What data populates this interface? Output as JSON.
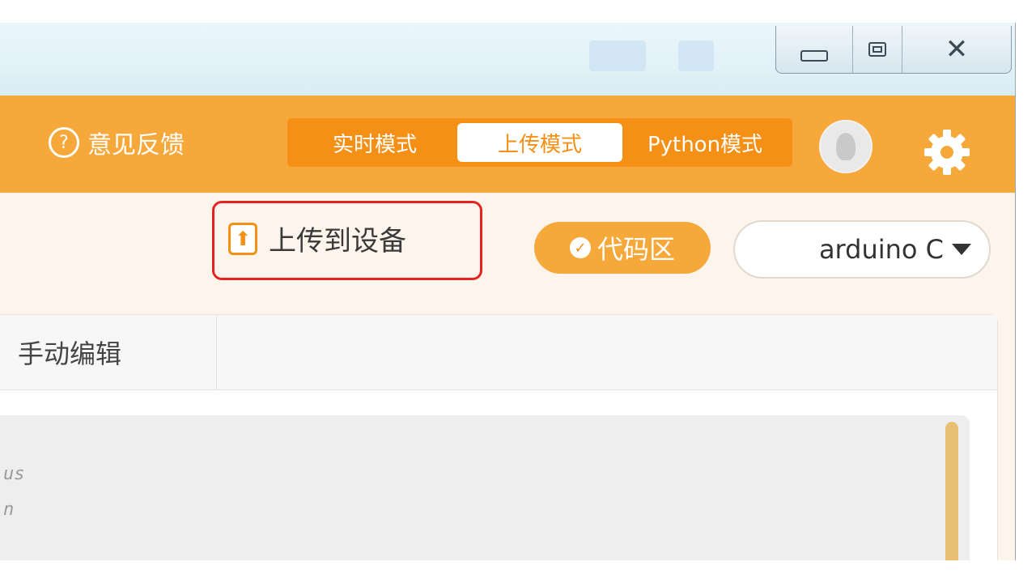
{
  "window": {
    "controls": {
      "minimize": "minimize",
      "maximize": "maximize",
      "close": "close"
    }
  },
  "header": {
    "feedback_label": "意见反馈",
    "modes": [
      {
        "label": "实时模式",
        "active": false
      },
      {
        "label": "上传模式",
        "active": true
      },
      {
        "label": "Python模式",
        "active": false
      }
    ]
  },
  "toolbar": {
    "upload_label": "上传到设备",
    "code_label": "代码区",
    "language_value": "arduino C"
  },
  "editor": {
    "tab_label": "手动编辑",
    "code_fragments": [
      "us",
      "n"
    ]
  },
  "colors": {
    "accent": "#f7a83a",
    "accent_dark": "#f39015",
    "highlight": "#e52222"
  }
}
